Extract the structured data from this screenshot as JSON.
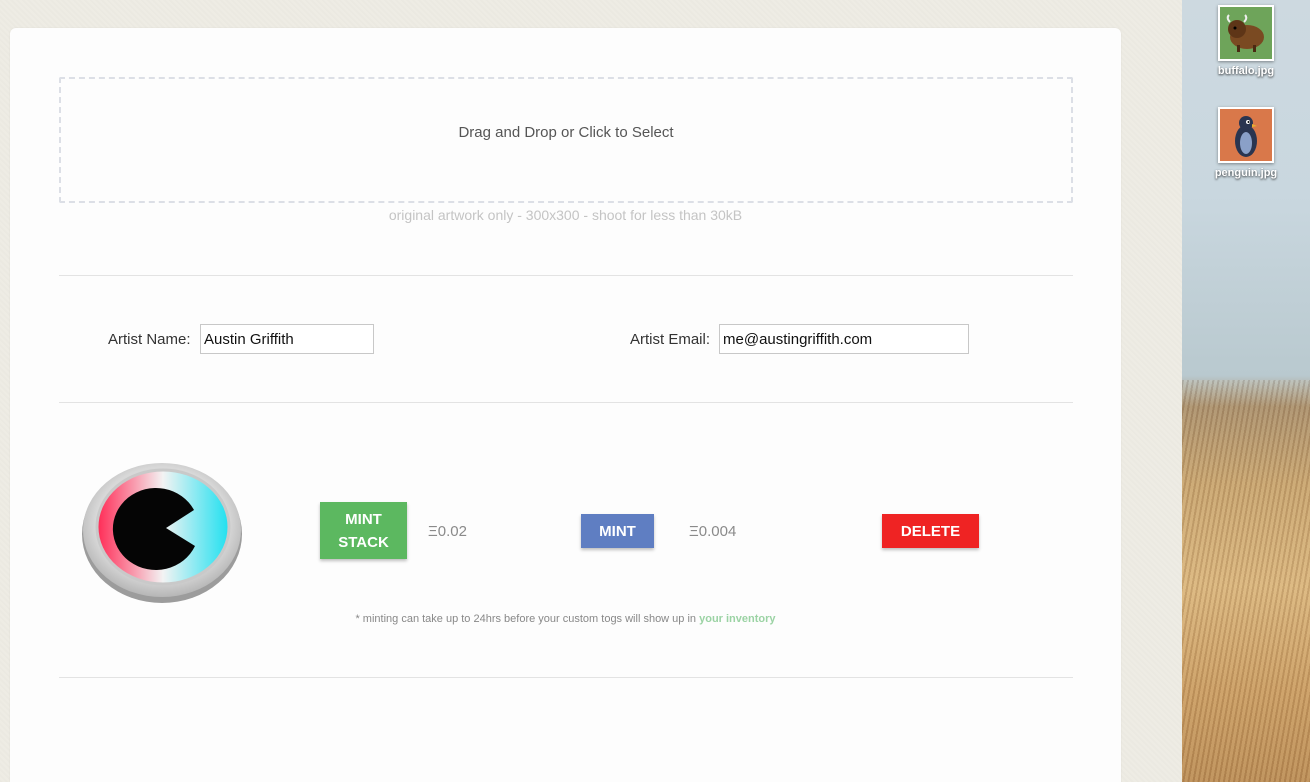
{
  "upload": {
    "dropzone_text": "Drag and Drop or Click to Select",
    "hint": "original artwork only - 300x300 - shoot for less than 30kB"
  },
  "artist": {
    "name_label": "Artist Name:",
    "name_value": "Austin Griffith",
    "email_label": "Artist Email:",
    "email_value": "me@austingriffith.com"
  },
  "actions": {
    "mint_stack_line1": "MINT",
    "mint_stack_line2": "STACK",
    "mint_stack_price": "Ξ0.02",
    "mint_label": "MINT",
    "mint_price": "Ξ0.004",
    "delete_label": "DELETE"
  },
  "note": {
    "text": "* minting can take up to 24hrs before your custom togs will show up in",
    "link_text": "your inventory"
  },
  "desktop": {
    "files": [
      {
        "name": "buffalo.jpg",
        "icon": "buffalo-icon"
      },
      {
        "name": "penguin.jpg",
        "icon": "penguin-icon"
      }
    ]
  },
  "colors": {
    "mint_stack": "#5cb860",
    "mint": "#5f7ec2",
    "delete": "#ef2323",
    "link": "#9bd3a4"
  }
}
